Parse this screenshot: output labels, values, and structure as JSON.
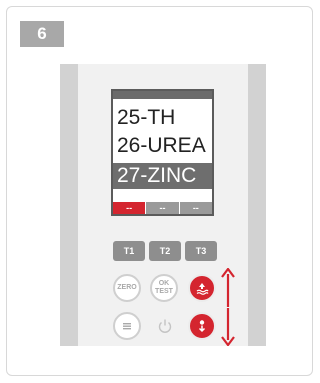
{
  "step_number": "6",
  "screen": {
    "items": [
      "25-TH",
      "26-UREA",
      "27-ZINC"
    ],
    "selected_index": 2,
    "softkeys": [
      "--",
      "--",
      "--"
    ]
  },
  "buttons": {
    "t1": "T1",
    "t2": "T2",
    "t3": "T3",
    "zero": "ZERO",
    "ok_test_line1": "OK",
    "ok_test_line2": "TEST"
  },
  "icons": {
    "menu": "menu-icon",
    "power": "power-icon",
    "scroll_up": "scroll-up-icon",
    "scroll_down": "scroll-down-icon"
  },
  "colors": {
    "accent_red": "#d4252f",
    "screen_highlight": "#6e6e6e",
    "button_gray": "#8e8e8e"
  }
}
